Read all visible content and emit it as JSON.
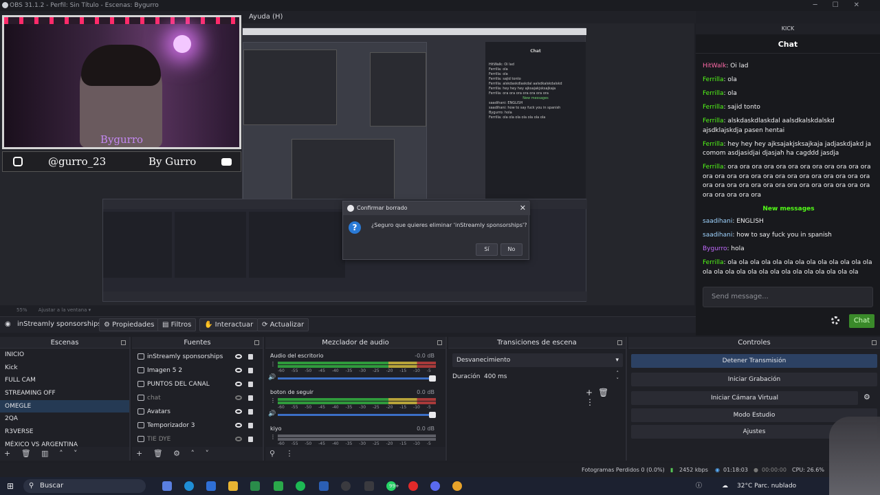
{
  "window": {
    "title": "OBS 31.1.2 - Perfil: Sin Título - Escenas: Bygurro"
  },
  "menu": {
    "help": "Ayuda (H)"
  },
  "overlay": {
    "name": "Bygurro",
    "handle": "@gurro_23",
    "by": "By Gurro"
  },
  "dialog": {
    "title": "Confirmar borrado",
    "message": "¿Seguro que quieres eliminar 'inStreamly sponsorships'?",
    "yes": "Sí",
    "no": "No"
  },
  "preview": {
    "zoom": "55%",
    "fit": "Ajustar a la ventana"
  },
  "source_toolbar": {
    "selected": "inStreamly sponsorships",
    "properties": "Propiedades",
    "filters": "Filtros",
    "interact": "Interactuar",
    "refresh": "Actualizar"
  },
  "scenes": {
    "header": "Escenas",
    "items": [
      "INICIO",
      "Kick",
      "FULL CAM",
      "STREAMING OFF",
      "OMEGLE",
      "2QA",
      "R3VERSE",
      "MÉXICO VS ARGENTINA"
    ],
    "selected_index": 4
  },
  "sources": {
    "header": "Fuentes",
    "items": [
      {
        "label": "inStreamly sponsorships",
        "visible": true
      },
      {
        "label": "Imagen 5 2",
        "visible": true
      },
      {
        "label": "PUNTOS DEL CANAL",
        "visible": true
      },
      {
        "label": "chat",
        "visible": false
      },
      {
        "label": "Avatars",
        "visible": true
      },
      {
        "label": "Temporizador 3",
        "visible": true
      },
      {
        "label": "TIE DYE",
        "visible": false
      }
    ]
  },
  "mixer": {
    "header": "Mezclador de audio",
    "ticks": "-60 -55 -50 -45 -40 -35 -30 -25 -20 -15 -10 -5 0",
    "channels": [
      {
        "name": "Audio del escritorio",
        "db": "-0.0 dB"
      },
      {
        "name": "boton de seguir",
        "db": "0.0 dB"
      },
      {
        "name": "kiyo",
        "db": "0.0 dB"
      }
    ]
  },
  "transitions": {
    "header": "Transiciones de escena",
    "selected": "Desvanecimiento",
    "duration_label": "Duración",
    "duration_value": "400 ms"
  },
  "controls": {
    "header": "Controles",
    "stop_stream": "Detener Transmisión",
    "start_recording": "Iniciar Grabación",
    "virtual_cam": "Iniciar Cámara Virtual",
    "studio_mode": "Modo Estudio",
    "settings": "Ajustes"
  },
  "chat": {
    "platform": "KICK",
    "title": "Chat",
    "messages": [
      {
        "user": "HitWalk",
        "text": ": Oi lad",
        "color": "#ff6aa8"
      },
      {
        "user": "Ferrilla",
        "text": ": ola",
        "color": "#53fc18"
      },
      {
        "user": "Ferrilla",
        "text": ": ola",
        "color": "#53fc18"
      },
      {
        "user": "Ferrilla",
        "text": ": sajid tonto",
        "color": "#53fc18"
      },
      {
        "user": "Ferrilla",
        "text": ": alskdaskdlaskdal aalsdkalskdalskd ajsdklajskdja pasen hentai",
        "color": "#53fc18"
      },
      {
        "user": "Ferrilla",
        "text": ": hey hey hey ajksajakjsksajkaja jadjaskdjakd ja comom asdjasidjai djasjah ha cagddd jasdja",
        "color": "#53fc18"
      },
      {
        "user": "Ferrilla",
        "text": ": ora ora ora ora ora ora ora ora ora ora ora ora ora ora ora ora ora ora ora ora ora ora ora ora ora ora ora ora ora ora ora ora ora ora ora ora ora ora ora ora ora ora ora ora ora",
        "color": "#53fc18"
      }
    ],
    "new_messages": "New messages",
    "after": [
      {
        "user": "saadihani",
        "text": ": ENGLISH",
        "color": "#9fd4ff"
      },
      {
        "user": "saadihani",
        "text": ": how to say fuck you in spanish",
        "color": "#9fd4ff"
      },
      {
        "user": "Bygurro",
        "text": ": hola",
        "color": "#c26bff"
      },
      {
        "user": "Ferrilla",
        "text": ": ola ola ola ola ola ola ola ola ola ola ola ola ola ola ola ola ola ola ola ola ola ola ola ola ola ola ola",
        "color": "#53fc18"
      }
    ],
    "placeholder": "Send message...",
    "send": "Chat"
  },
  "status": {
    "dropped": "Fotogramas Perdidos 0 (0.0%)",
    "bitrate": "2452 kbps",
    "stream_time": "01:18:03",
    "rec_time": "00:00:00",
    "cpu": "CPU: 26.6%"
  },
  "taskbar": {
    "search": "Buscar",
    "weather": "32°C  Parc. nublado",
    "badge": "99+"
  },
  "nested_chat": {
    "lines": [
      "HitWalk: Oi lad",
      "Ferrilla: ola",
      "Ferrilla: ola",
      "Ferrilla: sajid tonto",
      "Ferrilla: alskdaskdlaskdal aalsdkalskdalskd",
      "Ferrilla: hey hey hey ajksajakjsksajkaja",
      "Ferrilla: ora ora ora ora ora ora ora",
      "New messages",
      "saadihani: ENGLISH",
      "saadihani: how to say fuck you in spanish",
      "Bygurro: hola",
      "Ferrilla: ola ola ola ola ola ola ola"
    ]
  }
}
